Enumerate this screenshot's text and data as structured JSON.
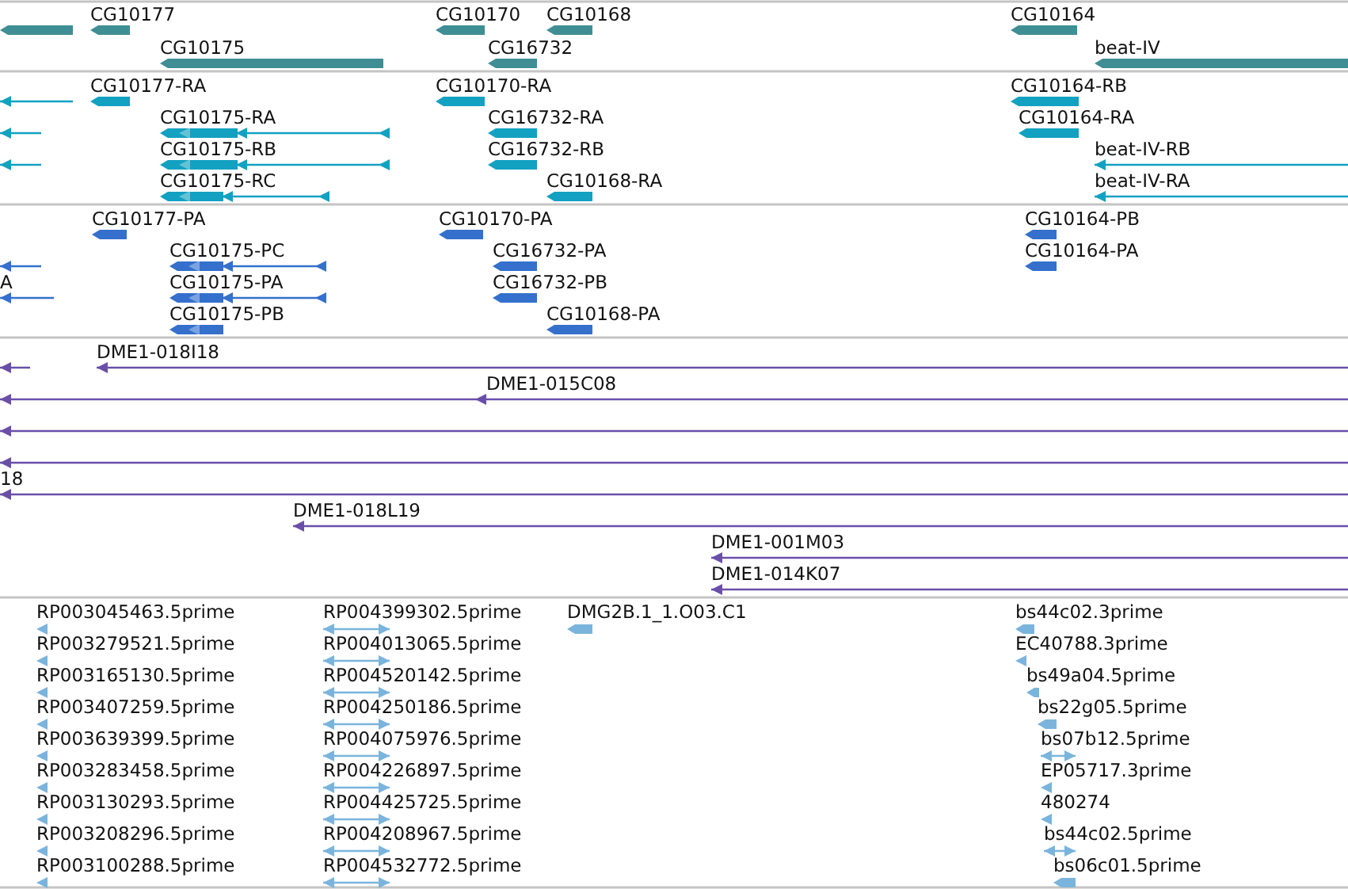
{
  "tracks": [
    {
      "color": "#3f8e94",
      "features": [
        {
          "kind": "block"
        },
        {
          "kind": "block",
          "label": "CG10177"
        },
        {
          "kind": "block",
          "label": "CG10170"
        },
        {
          "kind": "block",
          "label": "CG10168"
        },
        {
          "kind": "block",
          "label": "CG10175"
        },
        {
          "kind": "block",
          "label": "CG16732"
        },
        {
          "kind": "block",
          "label": "CG10164"
        },
        {
          "kind": "block",
          "label": "beat-IV"
        }
      ]
    },
    {
      "color": "#12a1c1",
      "features": [
        {
          "kind": "line"
        },
        {
          "kind": "block",
          "label": "CG10177-RA"
        },
        {
          "kind": "block",
          "label": "CG10170-RA"
        },
        {
          "kind": "block",
          "label": "CG10164-RB"
        },
        {
          "kind": "line"
        },
        {
          "kind": "gapped",
          "label": "CG10175-RA"
        },
        {
          "kind": "block",
          "label": "CG16732-RA"
        },
        {
          "kind": "block",
          "label": "CG10164-RA"
        },
        {
          "kind": "line"
        },
        {
          "kind": "gapped",
          "label": "CG10175-RB"
        },
        {
          "kind": "block",
          "label": "CG16732-RB"
        },
        {
          "kind": "line",
          "label": "beat-IV-RB"
        },
        {
          "kind": "gapped",
          "label": "CG10175-RC"
        },
        {
          "kind": "block",
          "label": "CG10168-RA"
        },
        {
          "kind": "line",
          "label": "beat-IV-RA"
        }
      ]
    },
    {
      "color": "#3470cc",
      "features": [
        {
          "kind": "block",
          "label": "CG10177-PA"
        },
        {
          "kind": "block",
          "label": "CG10170-PA"
        },
        {
          "kind": "block",
          "label": "CG10164-PB"
        },
        {
          "kind": "line"
        },
        {
          "kind": "gapped",
          "label": "CG10175-PC"
        },
        {
          "kind": "block",
          "label": "CG16732-PA"
        },
        {
          "kind": "block",
          "label": "CG10164-PA"
        },
        {
          "kind": "line",
          "label": "A"
        },
        {
          "kind": "gapped",
          "label": "CG10175-PA"
        },
        {
          "kind": "block",
          "label": "CG16732-PB"
        },
        {
          "kind": "gapped",
          "label": "CG10175-PB"
        },
        {
          "kind": "block",
          "label": "CG10168-PA"
        }
      ]
    },
    {
      "color": "#6a4fa8",
      "features": [
        {
          "kind": "line"
        },
        {
          "kind": "line",
          "label": "DME1-018I18"
        },
        {
          "kind": "line"
        },
        {
          "kind": "line",
          "label": "DME1-015C08"
        },
        {
          "kind": "line"
        },
        {
          "kind": "line"
        },
        {
          "kind": "line",
          "label": "18"
        },
        {
          "kind": "line",
          "label": "DME1-018L19"
        },
        {
          "kind": "line",
          "label": "DME1-001M03"
        },
        {
          "kind": "line",
          "label": "DME1-014K07"
        }
      ]
    },
    {
      "color": "#7ab4dc",
      "features": [
        {
          "kind": "mark",
          "label": "RP003045463.5prime"
        },
        {
          "kind": "mark",
          "label": "RP003279521.5prime"
        },
        {
          "kind": "mark",
          "label": "RP003165130.5prime"
        },
        {
          "kind": "mark",
          "label": "RP003407259.5prime"
        },
        {
          "kind": "mark",
          "label": "RP003639399.5prime"
        },
        {
          "kind": "mark",
          "label": "RP003283458.5prime"
        },
        {
          "kind": "mark",
          "label": "RP003130293.5prime"
        },
        {
          "kind": "mark",
          "label": "RP003208296.5prime"
        },
        {
          "kind": "mark",
          "label": "RP003100288.5prime"
        },
        {
          "kind": "span",
          "label": "RP004399302.5prime"
        },
        {
          "kind": "span",
          "label": "RP004013065.5prime"
        },
        {
          "kind": "span",
          "label": "RP004520142.5prime"
        },
        {
          "kind": "span",
          "label": "RP004250186.5prime"
        },
        {
          "kind": "span",
          "label": "RP004075976.5prime"
        },
        {
          "kind": "span",
          "label": "RP004226897.5prime"
        },
        {
          "kind": "span",
          "label": "RP004425725.5prime"
        },
        {
          "kind": "span",
          "label": "RP004208967.5prime"
        },
        {
          "kind": "span",
          "label": "RP004532772.5prime"
        },
        {
          "kind": "block",
          "label": "DMG2B.1_1.O03.C1"
        },
        {
          "kind": "block",
          "label": "bs44c02.3prime"
        },
        {
          "kind": "mark",
          "label": "EC40788.3prime"
        },
        {
          "kind": "block",
          "label": "bs49a04.5prime"
        },
        {
          "kind": "block",
          "label": "bs22g05.5prime"
        },
        {
          "kind": "span",
          "label": "bs07b12.5prime"
        },
        {
          "kind": "mark",
          "label": "EP05717.3prime"
        },
        {
          "kind": "mark",
          "label": "480274"
        },
        {
          "kind": "span",
          "label": "bs44c02.5prime"
        },
        {
          "kind": "block",
          "label": "bs06c01.5prime"
        }
      ]
    }
  ]
}
